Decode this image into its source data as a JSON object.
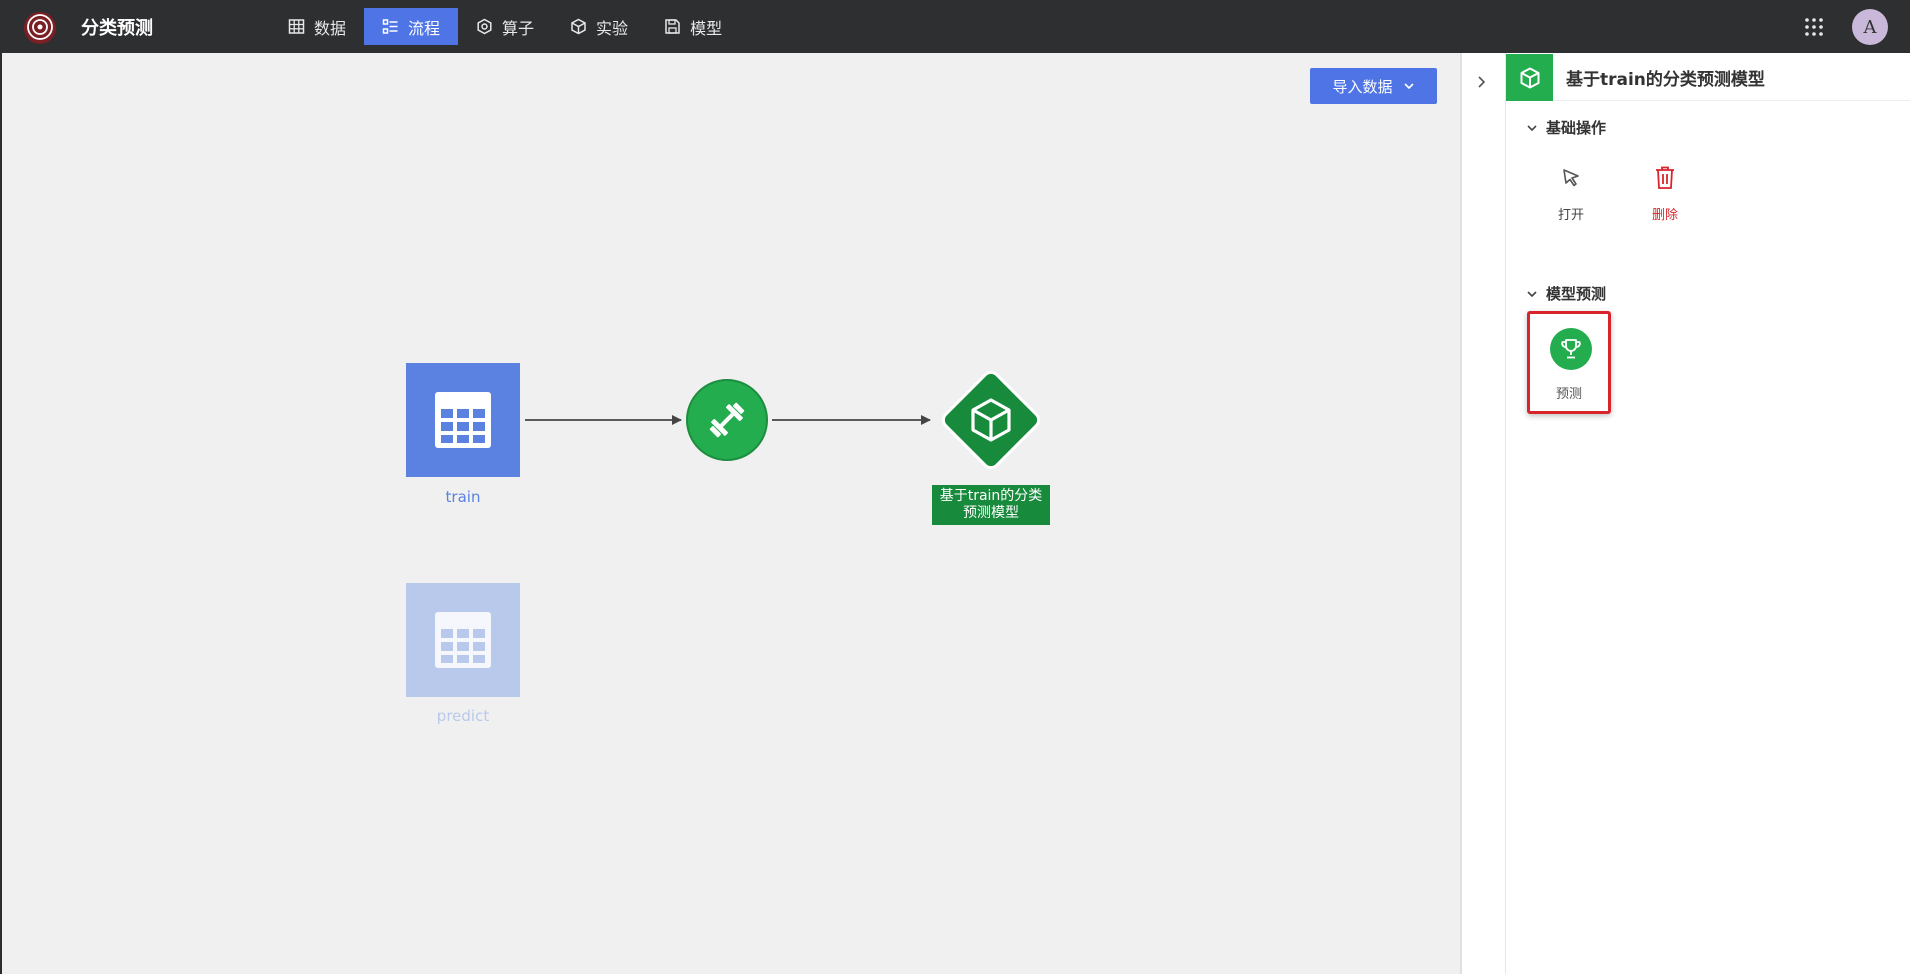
{
  "app": {
    "title": "分类预测",
    "avatar_initial": "A"
  },
  "nav": [
    {
      "label": "数据",
      "icon": "table-icon",
      "active": false
    },
    {
      "label": "流程",
      "icon": "flow-icon",
      "active": true
    },
    {
      "label": "算子",
      "icon": "operator-icon",
      "active": false
    },
    {
      "label": "实验",
      "icon": "cube-icon",
      "active": false
    },
    {
      "label": "模型",
      "icon": "save-icon",
      "active": false
    }
  ],
  "canvas": {
    "import_button": "导入数据",
    "nodes": {
      "train": {
        "label": "train",
        "icon": "table-icon"
      },
      "predict": {
        "label": "predict",
        "icon": "table-icon"
      },
      "trainer": {
        "icon": "dumbbell-icon"
      },
      "model": {
        "label_line1": "基于train的分类",
        "label_line2": "预测模型",
        "icon": "cube-icon"
      }
    }
  },
  "panel": {
    "title": "基于train的分类预测模型",
    "header_icon": "cube-icon",
    "sections": [
      {
        "title": "基础操作",
        "actions": [
          {
            "label": "打开",
            "icon": "cursor-icon",
            "color": "#555555"
          },
          {
            "label": "删除",
            "icon": "trash-icon",
            "color": "#d8252c"
          }
        ]
      },
      {
        "title": "模型预测",
        "actions": [
          {
            "label": "预测",
            "icon": "trophy-icon",
            "color": "#24ad4e"
          }
        ]
      }
    ]
  },
  "colors": {
    "accent": "#4e74e6",
    "green": "#24ad4e",
    "dark_green": "#178a3c",
    "danger": "#d8252c",
    "topbar": "#2e2f31"
  }
}
